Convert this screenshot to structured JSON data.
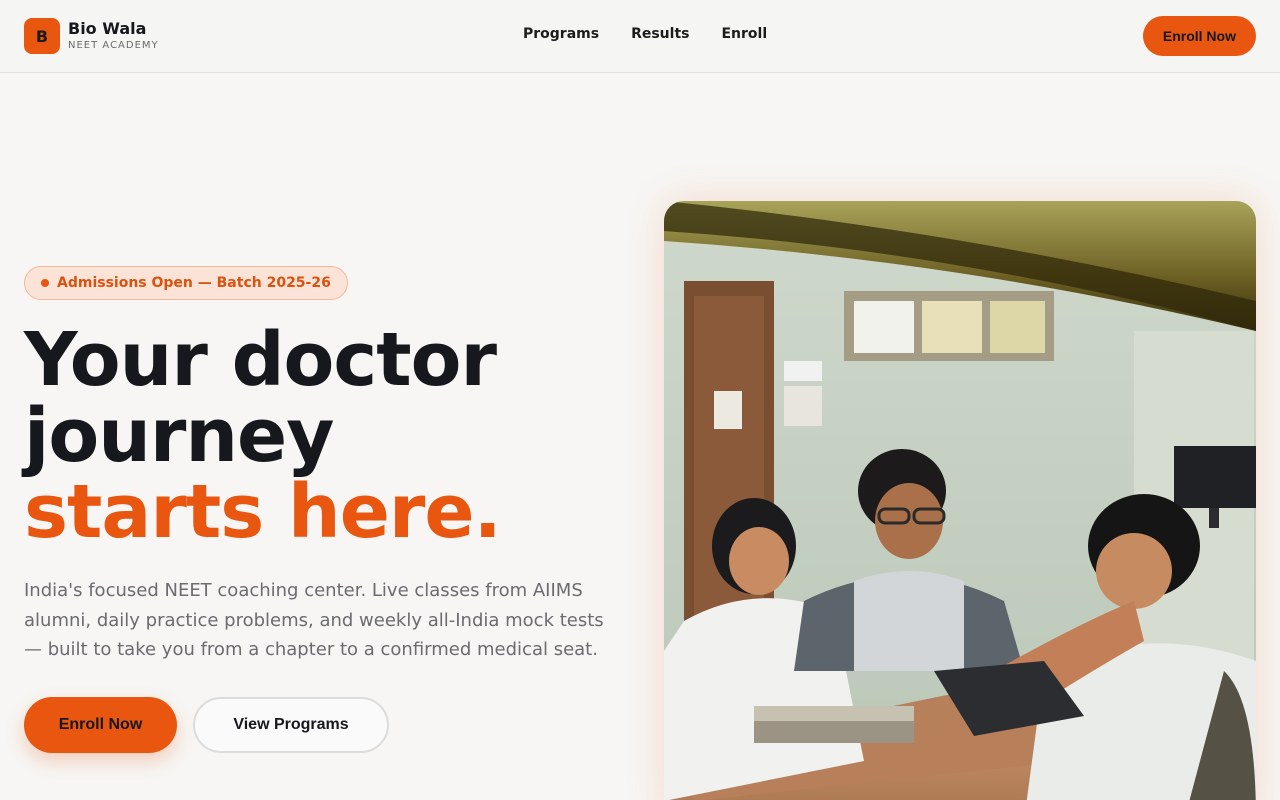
{
  "brand": {
    "initial": "B",
    "name": "Bio Wala",
    "tagline": "NEET ACADEMY"
  },
  "nav": {
    "links": [
      "Programs",
      "Results",
      "Enroll"
    ],
    "cta": "Enroll Now"
  },
  "hero": {
    "badge": "Admissions Open — Batch 2025-26",
    "headline_line1": "Your doctor",
    "headline_line2": "journey",
    "headline_accent": "starts here.",
    "lead": "India's focused NEET coaching center. Live classes from AIIMS alumni, daily practice problems, and weekly all-India mock tests — built to take you from a chapter to a confirmed medical seat.",
    "primary_cta": "Enroll Now",
    "secondary_cta": "View Programs"
  },
  "colors": {
    "accent": "#e8560f",
    "ink": "#16181d",
    "muted": "#6b6b70",
    "background": "#f7f6f4"
  }
}
